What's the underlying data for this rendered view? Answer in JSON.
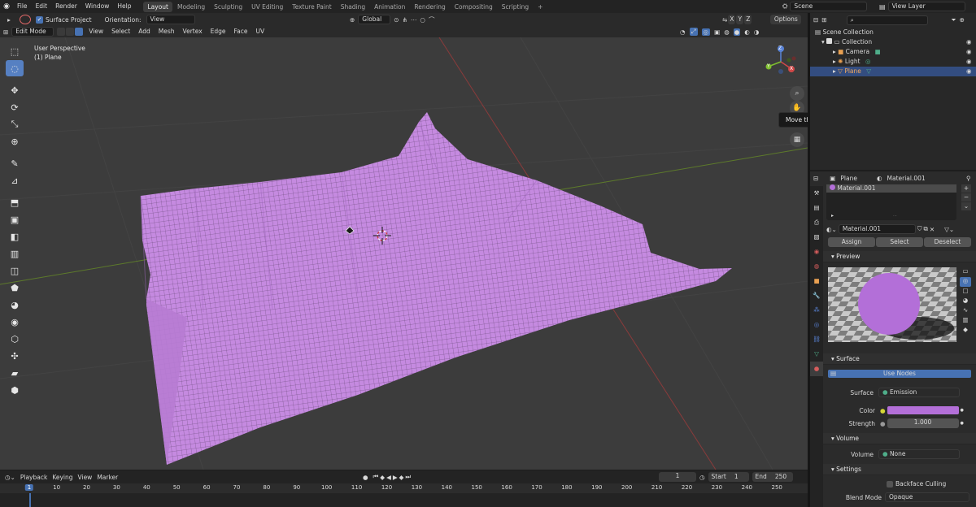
{
  "topbar": {
    "menus": [
      "File",
      "Edit",
      "Render",
      "Window",
      "Help"
    ],
    "workspaces": [
      "Layout",
      "Modeling",
      "Sculpting",
      "UV Editing",
      "Texture Paint",
      "Shading",
      "Animation",
      "Rendering",
      "Compositing",
      "Scripting"
    ],
    "active_workspace": "Layout",
    "add_workspace": "+",
    "scene_label": "Scene",
    "view_layer_label": "View Layer"
  },
  "viewport_header": {
    "surface_project_label": "Surface Project",
    "orientation_label": "Orientation:",
    "orientation_value": "View",
    "mode": "Edit Mode",
    "menus": [
      "View",
      "Select",
      "Add",
      "Mesh",
      "Vertex",
      "Edge",
      "Face",
      "UV"
    ],
    "transform_orientation": "Global",
    "axes": [
      "X",
      "Y",
      "Z"
    ],
    "options_label": "Options"
  },
  "viewport": {
    "perspective_label": "User Perspective",
    "object_label": "(1) Plane",
    "tooltip": "Move the view",
    "gizmo_axes": [
      "X",
      "Y",
      "Z"
    ],
    "mesh_color": "#c58ae0"
  },
  "toolbar": {
    "tools": [
      "select-box-icon",
      "cursor-icon",
      "move-icon",
      "rotate-icon",
      "scale-icon",
      "transform-icon",
      "annotate-icon",
      "measure-icon",
      "extrude-icon",
      "inset-icon",
      "bevel-icon",
      "loop-cut-icon",
      "knife-icon",
      "poly-build-icon",
      "spin-icon",
      "smooth-icon",
      "edge-slide-icon",
      "shrink-fatten-icon",
      "shear-icon",
      "rip-icon"
    ]
  },
  "outliner": {
    "search_placeholder": "",
    "items": [
      {
        "label": "Scene Collection",
        "indent": 0
      },
      {
        "label": "Collection",
        "indent": 1
      },
      {
        "label": "Camera",
        "indent": 2
      },
      {
        "label": "Light",
        "indent": 2
      },
      {
        "label": "Plane",
        "indent": 2
      }
    ]
  },
  "properties": {
    "breadcrumb_object": "Plane",
    "breadcrumb_material": "Material.001",
    "slot_name": "Material.001",
    "material_name": "Material.001",
    "assign_label": "Assign",
    "select_label": "Select",
    "deselect_label": "Deselect",
    "preview_label": "Preview",
    "surface_panel": "Surface",
    "use_nodes_label": "Use Nodes",
    "surface_label": "Surface",
    "surface_value": "Emission",
    "color_label": "Color",
    "color_value": "#b36fd8",
    "strength_label": "Strength",
    "strength_value": "1.000",
    "volume_panel": "Volume",
    "volume_label": "Volume",
    "volume_value": "None",
    "settings_panel": "Settings",
    "backface_label": "Backface Culling",
    "blend_mode_label": "Blend Mode",
    "blend_mode_value": "Opaque"
  },
  "timeline": {
    "menus": [
      "Playback",
      "Keying",
      "View",
      "Marker"
    ],
    "current_frame": "1",
    "start_label": "Start",
    "start_value": "1",
    "end_label": "End",
    "end_value": "250",
    "ruler": [
      "1",
      "10",
      "20",
      "30",
      "40",
      "50",
      "60",
      "70",
      "80",
      "90",
      "100",
      "110",
      "120",
      "130",
      "140",
      "150",
      "160",
      "170",
      "180",
      "190",
      "200",
      "210",
      "220",
      "230",
      "240",
      "250"
    ]
  }
}
